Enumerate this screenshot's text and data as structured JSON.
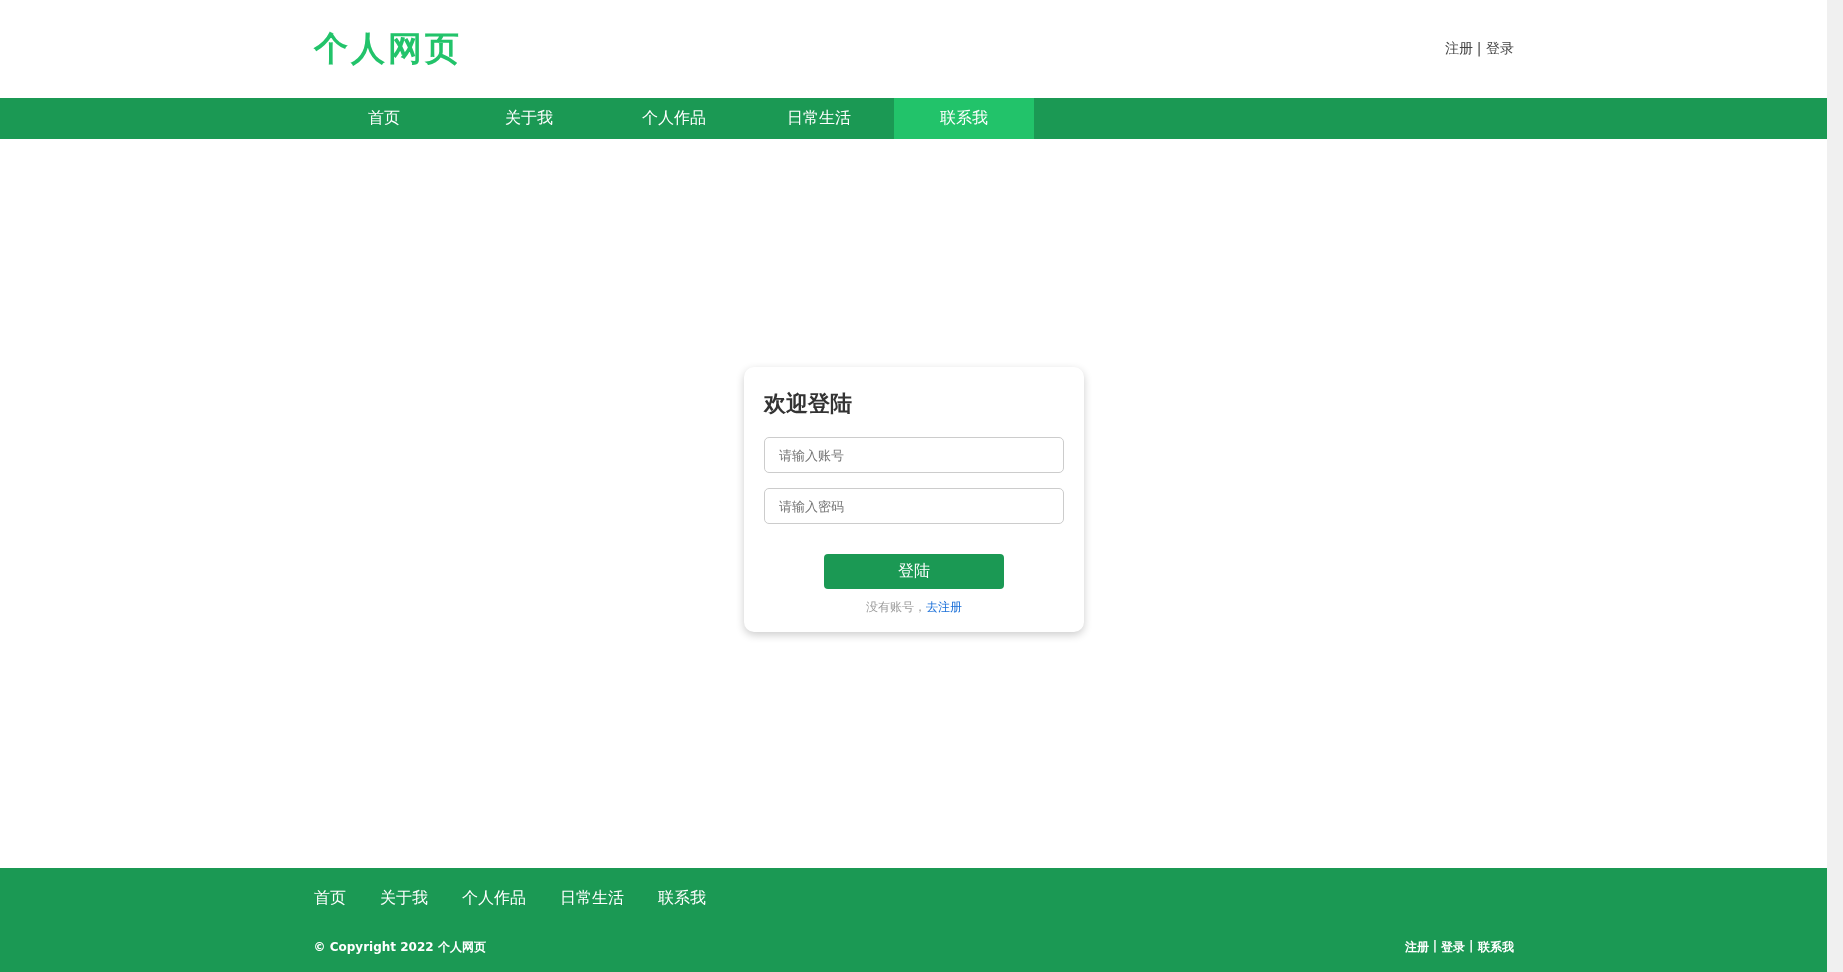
{
  "header": {
    "logo": "个人网页",
    "links": [
      "注册",
      "登录"
    ],
    "separator": "|"
  },
  "nav": [
    {
      "label": "首页",
      "selected": false
    },
    {
      "label": "关于我",
      "selected": false
    },
    {
      "label": "个人作品",
      "selected": false
    },
    {
      "label": "日常生活",
      "selected": false
    },
    {
      "label": "联系我",
      "selected": true
    }
  ],
  "login": {
    "title": "欢迎登陆",
    "fields": [
      {
        "placeholder": "请输入账号"
      },
      {
        "placeholder": "请输入密码"
      }
    ],
    "button": "登陆",
    "prompt": "没有账号，",
    "register_link": "去注册"
  },
  "footer": {
    "links": [
      "首页",
      "关于我",
      "个人作品",
      "日常生活",
      "联系我"
    ],
    "copyright": "© Copyright 2022 个人网页",
    "bottom_links": [
      "注册",
      "登录",
      "联系我"
    ],
    "separator": "|"
  }
}
